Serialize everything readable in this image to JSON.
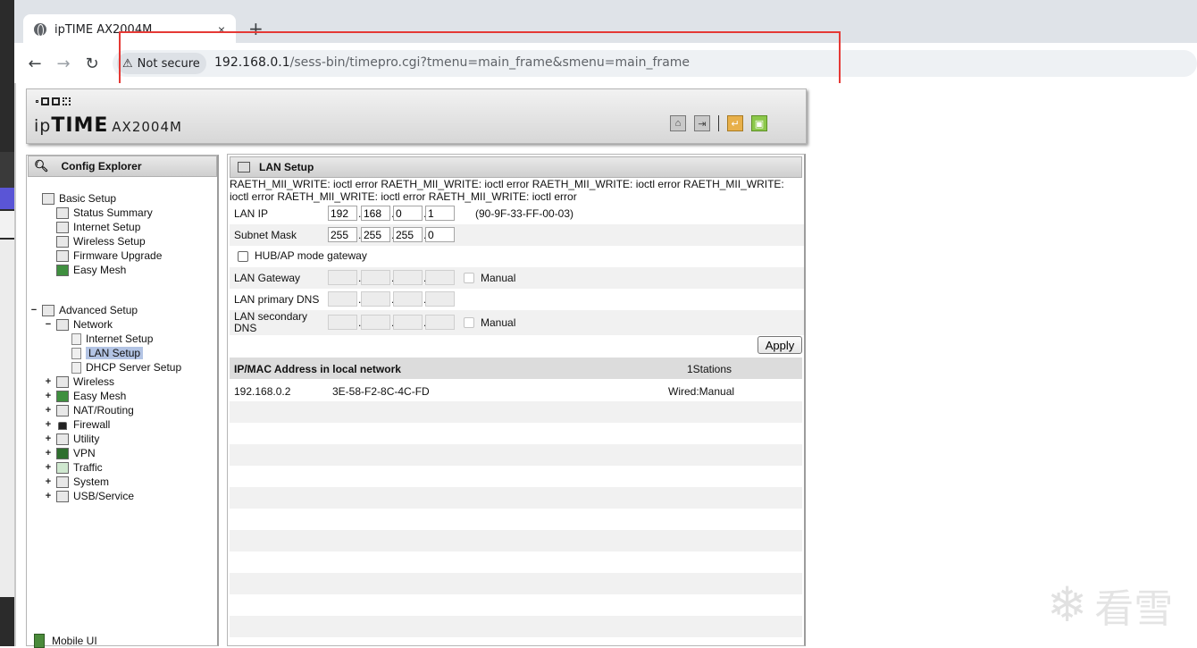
{
  "browser": {
    "tab_title": "ipTIME AX2004M",
    "tab_close": "×",
    "new_tab": "+",
    "back": "←",
    "forward": "→",
    "reload": "↻",
    "security_label": "Not secure",
    "url_host": "192.168.0.1",
    "url_path": "/sess-bin/timepro.cgi?tmenu=main_frame&smenu=main_frame"
  },
  "header": {
    "logo_prefix": "ip",
    "logo_brand": "TIME",
    "model": "AX2004M"
  },
  "explorer": {
    "title": "Config Explorer",
    "basic_setup": "Basic Setup",
    "basic_items": [
      "Status Summary",
      "Internet Setup",
      "Wireless Setup",
      "Firmware Upgrade",
      "Easy Mesh"
    ],
    "advanced_setup": "Advanced Setup",
    "network": "Network",
    "network_items": [
      "Internet Setup",
      "LAN Setup",
      "DHCP Server Setup"
    ],
    "advanced_items": [
      "Wireless",
      "Easy Mesh",
      "NAT/Routing",
      "Firewall",
      "Utility",
      "VPN",
      "Traffic",
      "System",
      "USB/Service"
    ],
    "mobile_ui": "Mobile UI",
    "expand_symbol": "+",
    "collapse_symbol": "−"
  },
  "lan": {
    "title": "LAN Setup",
    "error_text": "RAETH_MII_WRITE: ioctl error RAETH_MII_WRITE: ioctl error RAETH_MII_WRITE: ioctl error RAETH_MII_WRITE: ioctl error RAETH_MII_WRITE: ioctl error RAETH_MII_WRITE: ioctl error",
    "lan_ip_label": "LAN IP",
    "lan_ip": [
      "192",
      "168",
      "0",
      "1"
    ],
    "mac": "(90-9F-33-FF-00-03)",
    "subnet_label": "Subnet Mask",
    "subnet": [
      "255",
      "255",
      "255",
      "0"
    ],
    "hub_ap_label": "HUB/AP mode gateway",
    "gateway_label": "LAN Gateway",
    "manual_label": "Manual",
    "primary_dns_label": "LAN primary DNS",
    "secondary_dns_label": "LAN secondary DNS",
    "apply": "Apply"
  },
  "stations": {
    "header": "IP/MAC Address in local network",
    "count": "1Stations",
    "rows": [
      {
        "ip": "192.168.0.2",
        "mac": "3E-58-F2-8C-4C-FD",
        "type": "Wired:Manual"
      }
    ]
  },
  "watermark": {
    "icon": "❄",
    "text": "看雪"
  }
}
